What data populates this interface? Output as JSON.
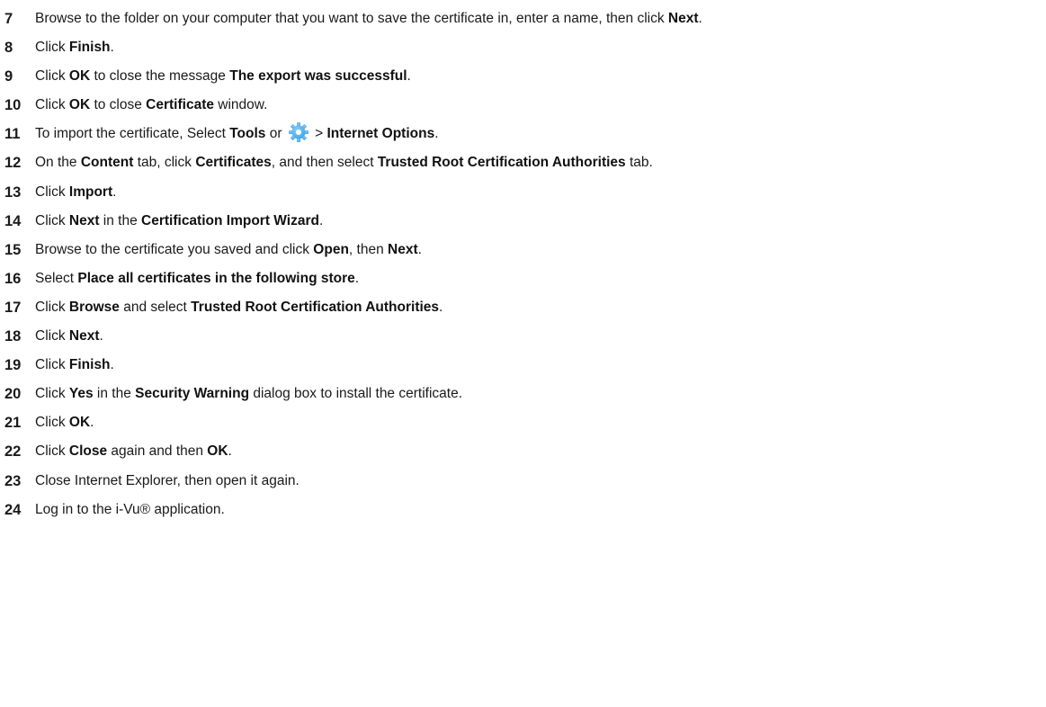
{
  "steps": [
    {
      "num": "7",
      "parts": [
        {
          "t": "Browse to the folder on your computer that you want to save the certificate in, enter a name, then click "
        },
        {
          "t": "Next",
          "b": true
        },
        {
          "t": "."
        }
      ]
    },
    {
      "num": "8",
      "parts": [
        {
          "t": "Click "
        },
        {
          "t": "Finish",
          "b": true
        },
        {
          "t": "."
        }
      ]
    },
    {
      "num": "9",
      "parts": [
        {
          "t": "Click "
        },
        {
          "t": "OK",
          "b": true
        },
        {
          "t": " to close the message "
        },
        {
          "t": "The export was successful",
          "b": true
        },
        {
          "t": "."
        }
      ]
    },
    {
      "num": "10",
      "parts": [
        {
          "t": "Click "
        },
        {
          "t": "OK",
          "b": true
        },
        {
          "t": " to close "
        },
        {
          "t": "Certificate",
          "b": true
        },
        {
          "t": " window."
        }
      ]
    },
    {
      "num": "11",
      "parts": [
        {
          "t": "To import the certificate, Select "
        },
        {
          "t": "Tools",
          "b": true
        },
        {
          "t": " or "
        },
        {
          "icon": "gear-icon"
        },
        {
          "t": " > "
        },
        {
          "t": "Internet Options",
          "b": true
        },
        {
          "t": "."
        }
      ]
    },
    {
      "num": "12",
      "parts": [
        {
          "t": "On the "
        },
        {
          "t": "Content",
          "b": true
        },
        {
          "t": " tab, click "
        },
        {
          "t": "Certificates",
          "b": true
        },
        {
          "t": ", and then select "
        },
        {
          "t": "Trusted Root Certification Authorities",
          "b": true
        },
        {
          "t": " tab."
        }
      ]
    },
    {
      "num": "13",
      "parts": [
        {
          "t": "Click "
        },
        {
          "t": "Import",
          "b": true
        },
        {
          "t": "."
        }
      ]
    },
    {
      "num": "14",
      "parts": [
        {
          "t": "Click "
        },
        {
          "t": "Next",
          "b": true
        },
        {
          "t": " in the "
        },
        {
          "t": "Certification Import Wizard",
          "b": true
        },
        {
          "t": "."
        }
      ]
    },
    {
      "num": "15",
      "parts": [
        {
          "t": "Browse to the certificate you saved and click "
        },
        {
          "t": "Open",
          "b": true
        },
        {
          "t": ", then "
        },
        {
          "t": "Next",
          "b": true
        },
        {
          "t": "."
        }
      ]
    },
    {
      "num": "16",
      "parts": [
        {
          "t": "Select "
        },
        {
          "t": "Place all certificates in the following store",
          "b": true
        },
        {
          "t": "."
        }
      ]
    },
    {
      "num": "17",
      "parts": [
        {
          "t": "Click "
        },
        {
          "t": "Browse",
          "b": true
        },
        {
          "t": " and select "
        },
        {
          "t": "Trusted Root Certification Authorities",
          "b": true
        },
        {
          "t": "."
        }
      ]
    },
    {
      "num": "18",
      "parts": [
        {
          "t": "Click "
        },
        {
          "t": "Next",
          "b": true
        },
        {
          "t": "."
        }
      ]
    },
    {
      "num": "19",
      "parts": [
        {
          "t": "Click "
        },
        {
          "t": "Finish",
          "b": true
        },
        {
          "t": "."
        }
      ]
    },
    {
      "num": "20",
      "parts": [
        {
          "t": "Click "
        },
        {
          "t": "Yes",
          "b": true
        },
        {
          "t": " in the "
        },
        {
          "t": "Security Warning",
          "b": true
        },
        {
          "t": " dialog box to install the certificate."
        }
      ]
    },
    {
      "num": "21",
      "parts": [
        {
          "t": "Click "
        },
        {
          "t": "OK",
          "b": true
        },
        {
          "t": "."
        }
      ]
    },
    {
      "num": "22",
      "parts": [
        {
          "t": "Click "
        },
        {
          "t": "Close",
          "b": true
        },
        {
          "t": " again and then "
        },
        {
          "t": "OK",
          "b": true
        },
        {
          "t": "."
        }
      ]
    },
    {
      "num": "23",
      "parts": [
        {
          "t": "Close Internet Explorer, then open it again."
        }
      ]
    },
    {
      "num": "24",
      "parts": [
        {
          "t": "Log in to the i-Vu® application."
        }
      ]
    }
  ],
  "icons": {
    "gear": {
      "name": "gear-icon",
      "color": "#3fa2e8",
      "highlight": "#8fd0f7"
    }
  }
}
